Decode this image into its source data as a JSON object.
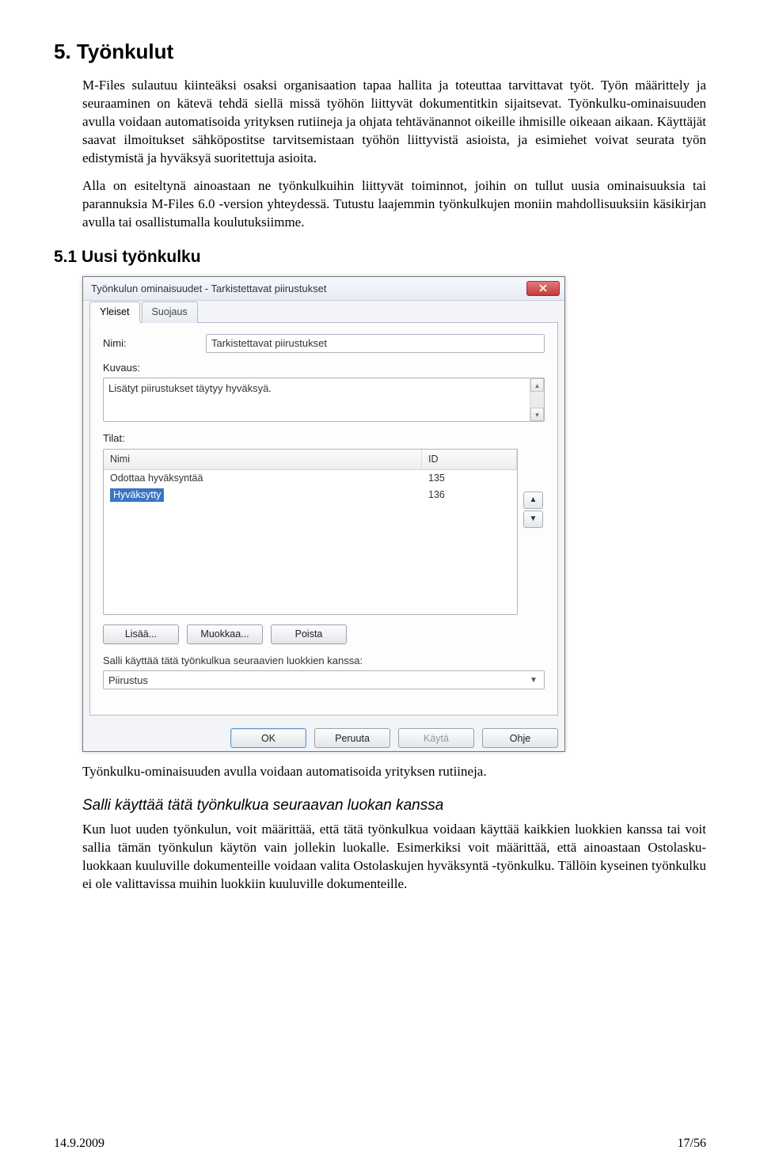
{
  "doc": {
    "h1": "5. Työnkulut",
    "p1": "M-Files sulautuu kiinteäksi osaksi organisaation tapaa hallita ja toteuttaa tarvittavat työt. Työn määrittely ja seuraaminen on kätevä tehdä siellä missä työhön liittyvät dokumentitkin sijaitsevat. Työnkulku-ominaisuuden avulla voidaan automatisoida yrityksen rutiineja ja ohjata tehtävänannot oikeille ihmisille oikeaan aikaan. Käyttäjät saavat ilmoitukset sähköpostitse tarvitsemistaan työhön liittyvistä asioista, ja esimiehet voivat seurata työn edistymistä ja hyväksyä suoritettuja asioita.",
    "p2": "Alla on esiteltynä ainoastaan ne työnkulkuihin liittyvät toiminnot, joihin on tullut uusia ominaisuuksia tai parannuksia M-Files 6.0 -version yhteydessä. Tutustu laajemmin työnkulkujen moniin mahdollisuuksiin käsikirjan avulla tai osallistumalla koulutuksiimme.",
    "h2": "5.1 Uusi työnkulku",
    "caption": "Työnkulku-ominaisuuden avulla voidaan automatisoida yrityksen rutiineja.",
    "h3": "Salli käyttää tätä työnkulkua seuraavan luokan kanssa",
    "p3": "Kun luot uuden työnkulun, voit määrittää, että tätä työnkulkua voidaan käyttää kaikkien luokkien kanssa tai voit sallia tämän työnkulun käytön vain jollekin luokalle. Esimerkiksi voit määrittää, että ainoastaan Ostolasku-luokkaan kuuluville dokumenteille voidaan valita Ostolaskujen hyväksyntä -työnkulku. Tällöin kyseinen työnkulku ei ole valittavissa muihin luokkiin kuuluville dokumenteille."
  },
  "dialog": {
    "title": "Työnkulun ominaisuudet - Tarkistettavat piirustukset",
    "tabs": {
      "active": "Yleiset",
      "other": "Suojaus"
    },
    "labels": {
      "nimi": "Nimi:",
      "kuvaus": "Kuvaus:",
      "tilat": "Tilat:",
      "salli": "Salli käyttää tätä työnkulkua seuraavien luokkien kanssa:"
    },
    "nimi_value": "Tarkistettavat piirustukset",
    "kuvaus_value": "Lisätyt piirustukset täytyy hyväksyä.",
    "states": {
      "header_nimi": "Nimi",
      "header_id": "ID",
      "rows": [
        {
          "nimi": "Odottaa hyväksyntää",
          "id": "135",
          "selected": false
        },
        {
          "nimi": "Hyväksytty",
          "id": "136",
          "selected": true
        }
      ]
    },
    "buttons": {
      "lisaa": "Lisää...",
      "muokkaa": "Muokkaa...",
      "poista": "Poista",
      "ok": "OK",
      "peruuta": "Peruuta",
      "kayta": "Käytä",
      "ohje": "Ohje"
    },
    "combo_value": "Piirustus"
  },
  "footer": {
    "date": "14.9.2009",
    "page": "17/56"
  }
}
